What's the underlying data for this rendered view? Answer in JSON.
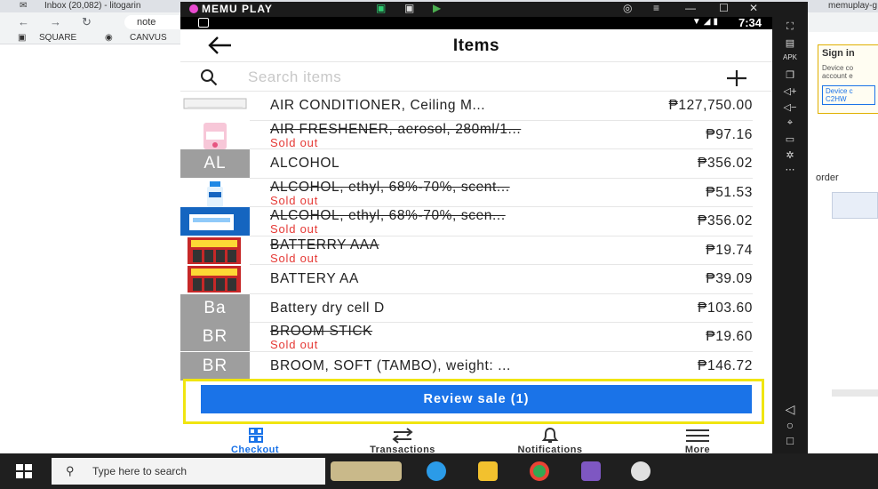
{
  "browser": {
    "tab_inbox": "Inbox (20,082) - litogarin",
    "tab_right": "memuplay-g",
    "address": "note",
    "bookmark_square": "SQUARE",
    "bookmark_canvus": "CANVUS"
  },
  "background_page": {
    "signin_title": "Sign in",
    "signin_line1": "Device co",
    "signin_line2": "account e",
    "device_code_label": "Device c",
    "device_code": "C2HW",
    "order_text": "order"
  },
  "taskbar": {
    "search_placeholder": "Type here to search"
  },
  "emulator": {
    "title": "MEMU PLAY",
    "status_time": "7:34"
  },
  "app": {
    "title": "Items",
    "search_placeholder": "Search items",
    "items": [
      {
        "name": "AIR CONDITIONER, Ceiling M...",
        "price": "₱127,750.00",
        "sold_out": "",
        "thumb_type": "image",
        "thumb_label": "",
        "thumb_icon": "air-conditioner-photo"
      },
      {
        "name": "AIR FRESHENER, aerosol, 280ml/1...",
        "price": "₱97.16",
        "sold_out": "Sold out",
        "thumb_type": "image",
        "thumb_label": "",
        "thumb_icon": "air-freshener-photo"
      },
      {
        "name": "ALCOHOL",
        "price": "₱356.02",
        "sold_out": "",
        "thumb_type": "letters",
        "thumb_label": "AL",
        "thumb_icon": ""
      },
      {
        "name": "ALCOHOL, ethyl, 68%-70%, scent...",
        "price": "₱51.53",
        "sold_out": "Sold out",
        "thumb_type": "image",
        "thumb_label": "",
        "thumb_icon": "alcohol-bottle-photo"
      },
      {
        "name": "ALCOHOL, ethyl, 68%-70%, scen...",
        "price": "₱356.02",
        "sold_out": "Sold out",
        "thumb_type": "image",
        "thumb_label": "",
        "thumb_icon": "alcohol-box-photo"
      },
      {
        "name": "BATTERRY AAA",
        "price": "₱19.74",
        "sold_out": "Sold out",
        "thumb_type": "image",
        "thumb_label": "",
        "thumb_icon": "battery-pack-photo"
      },
      {
        "name": "BATTERY AA",
        "price": "₱39.09",
        "sold_out": "",
        "thumb_type": "image",
        "thumb_label": "",
        "thumb_icon": "battery-pack-photo"
      },
      {
        "name": "Battery dry cell D",
        "price": "₱103.60",
        "sold_out": "",
        "thumb_type": "letters",
        "thumb_label": "Ba",
        "thumb_icon": ""
      },
      {
        "name": "BROOM STICK",
        "price": "₱19.60",
        "sold_out": "Sold out",
        "thumb_type": "letters",
        "thumb_label": "BR",
        "thumb_icon": ""
      },
      {
        "name": "BROOM, SOFT (TAMBO), weight: ...",
        "price": "₱146.72",
        "sold_out": "",
        "thumb_type": "letters",
        "thumb_label": "BR",
        "thumb_icon": ""
      }
    ],
    "review_button": "Review sale (1)",
    "nav": [
      {
        "label": "Checkout",
        "icon": "grid-icon",
        "active": true
      },
      {
        "label": "Transactions",
        "icon": "swap-arrows-icon",
        "active": false
      },
      {
        "label": "Notifications",
        "icon": "bell-icon",
        "active": false
      },
      {
        "label": "More",
        "icon": "menu-icon",
        "active": false
      }
    ]
  },
  "colors": {
    "accent": "#1a73e8",
    "sold_out": "#e53935",
    "highlight": "#f0e510",
    "thumb_gray": "#9e9e9e"
  }
}
